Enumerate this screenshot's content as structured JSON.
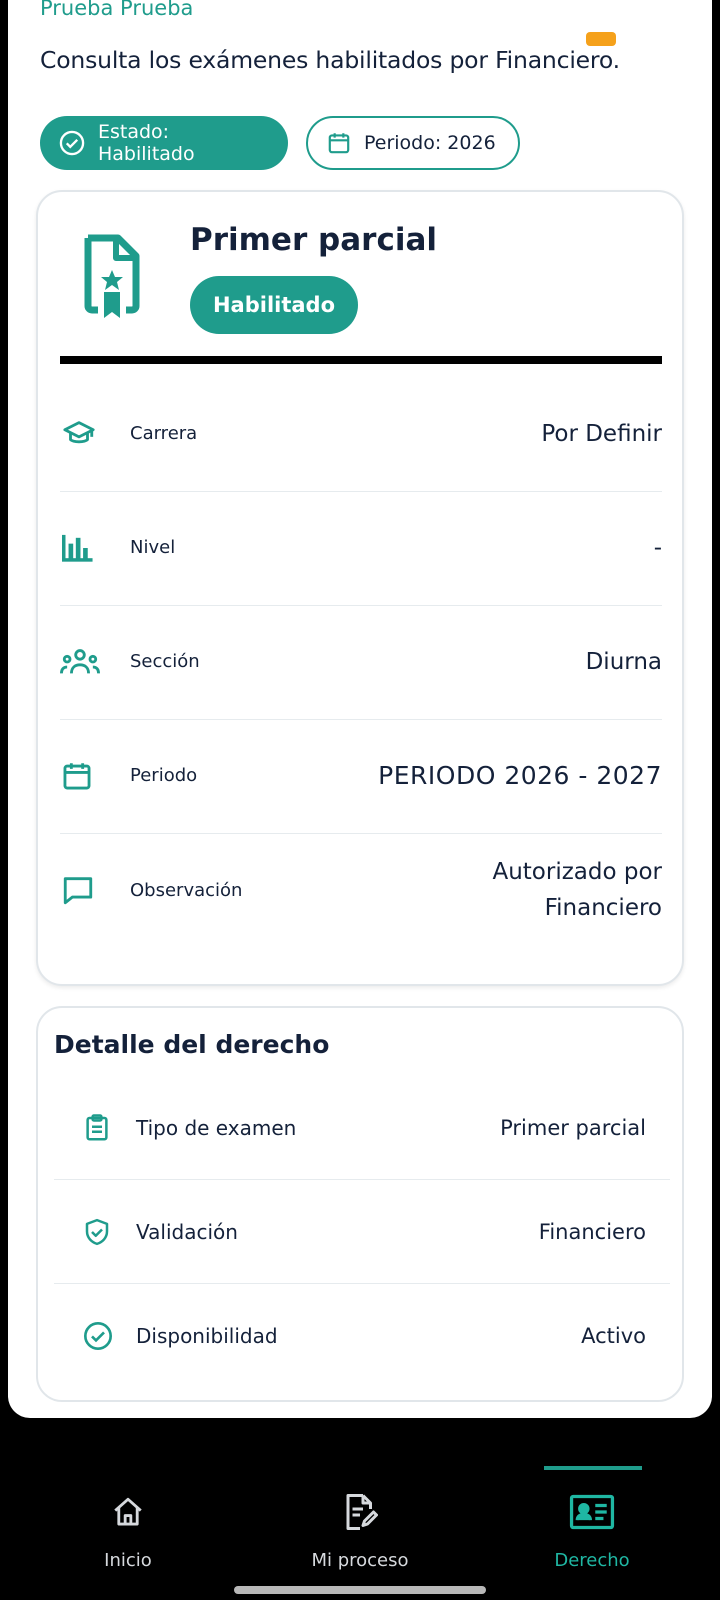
{
  "header": {
    "user_name": "Prueba Prueba",
    "subtitle": "Consulta los exámenes habilitados por Financiero."
  },
  "chips": {
    "estado": "Estado: Habilitado",
    "periodo": "Periodo: 2026"
  },
  "exam_card": {
    "title": "Primer parcial",
    "badge": "Habilitado",
    "rows": [
      {
        "label": "Carrera",
        "value": "Por Definir",
        "icon": "graduation-cap-icon"
      },
      {
        "label": "Nivel",
        "value": "-",
        "icon": "bar-chart-icon"
      },
      {
        "label": "Sección",
        "value": "Diurna",
        "icon": "group-icon"
      },
      {
        "label": "Periodo",
        "value": "PERIODO 2026 - 2027",
        "icon": "calendar-icon"
      },
      {
        "label": "Observación",
        "value_line1": "Autorizado por",
        "value_line2": "Financiero",
        "icon": "comment-icon"
      }
    ]
  },
  "detail_card": {
    "title": "Detalle del derecho",
    "rows": [
      {
        "label": "Tipo de examen",
        "value": "Primer parcial",
        "icon": "clipboard-icon"
      },
      {
        "label": "Validación",
        "value": "Financiero",
        "icon": "shield-check-icon"
      },
      {
        "label": "Disponibilidad",
        "value": "Activo",
        "icon": "check-circle-icon"
      }
    ]
  },
  "nav": {
    "items": [
      {
        "label": "Inicio",
        "icon": "home-icon"
      },
      {
        "label": "Mi proceso",
        "icon": "document-edit-icon"
      },
      {
        "label": "Derecho",
        "icon": "id-card-icon",
        "active": true
      }
    ]
  },
  "colors": {
    "accent": "#1f9c8c",
    "accent_light": "#1fb7a3",
    "text": "#14213a",
    "orange": "#f5a11b"
  }
}
